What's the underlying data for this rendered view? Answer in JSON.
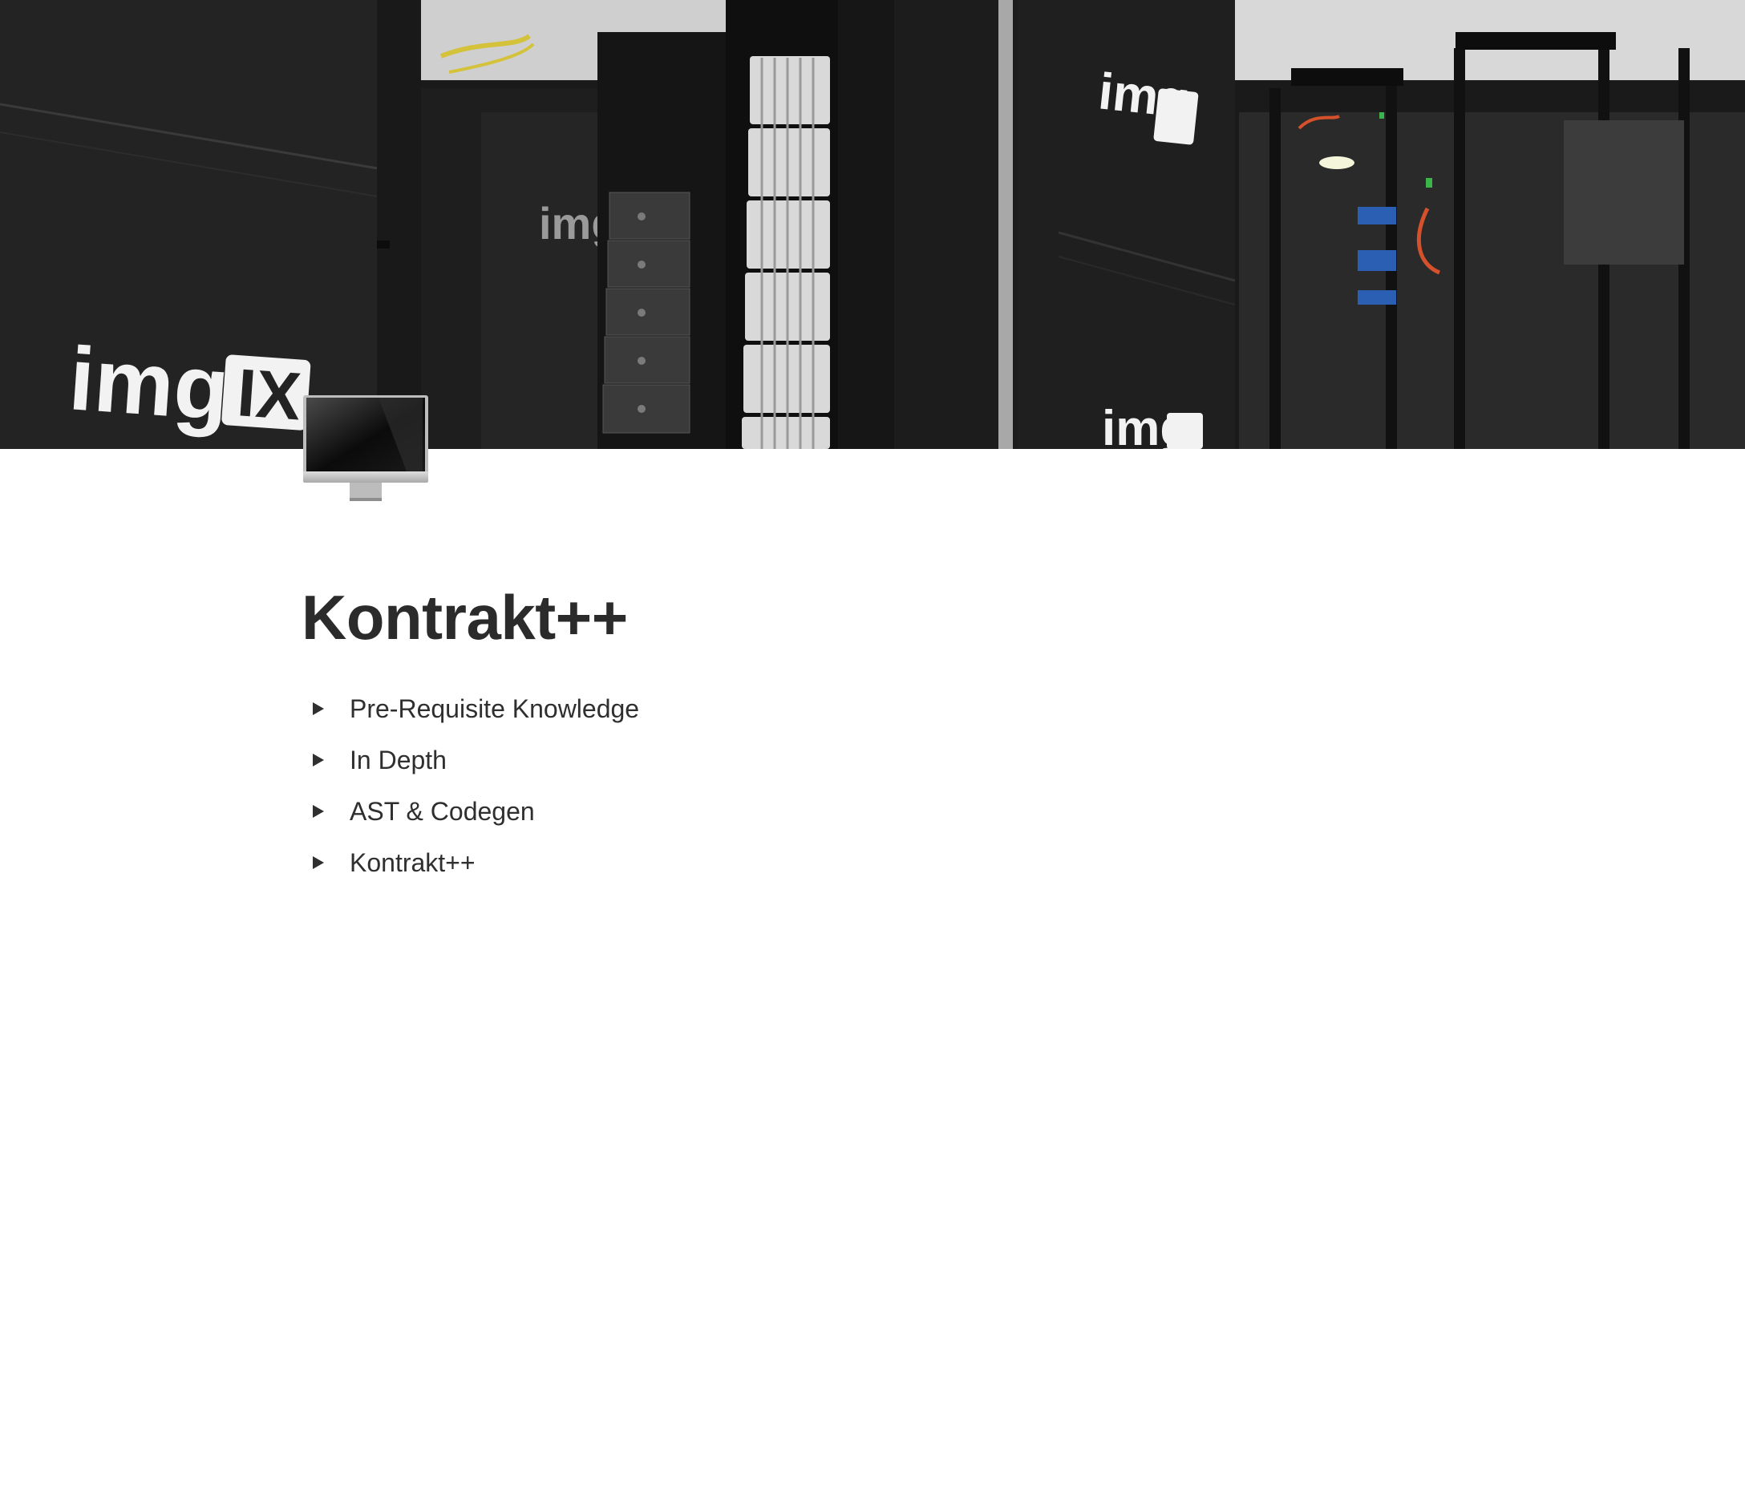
{
  "cover": {
    "logos": [
      "img",
      "IX"
    ]
  },
  "page": {
    "icon": "desktop-computer-icon",
    "title": "Kontrakt++"
  },
  "toggles": [
    {
      "label": "Pre-Requisite Knowledge",
      "icon": "triangle-right-icon"
    },
    {
      "label": "In Depth",
      "icon": "triangle-right-icon"
    },
    {
      "label": "AST & Codegen",
      "icon": "triangle-right-icon"
    },
    {
      "label": "Kontrakt++",
      "icon": "triangle-right-icon"
    }
  ],
  "colors": {
    "text": "#2f2f2f",
    "title": "#2b2b2b",
    "background": "#ffffff"
  }
}
